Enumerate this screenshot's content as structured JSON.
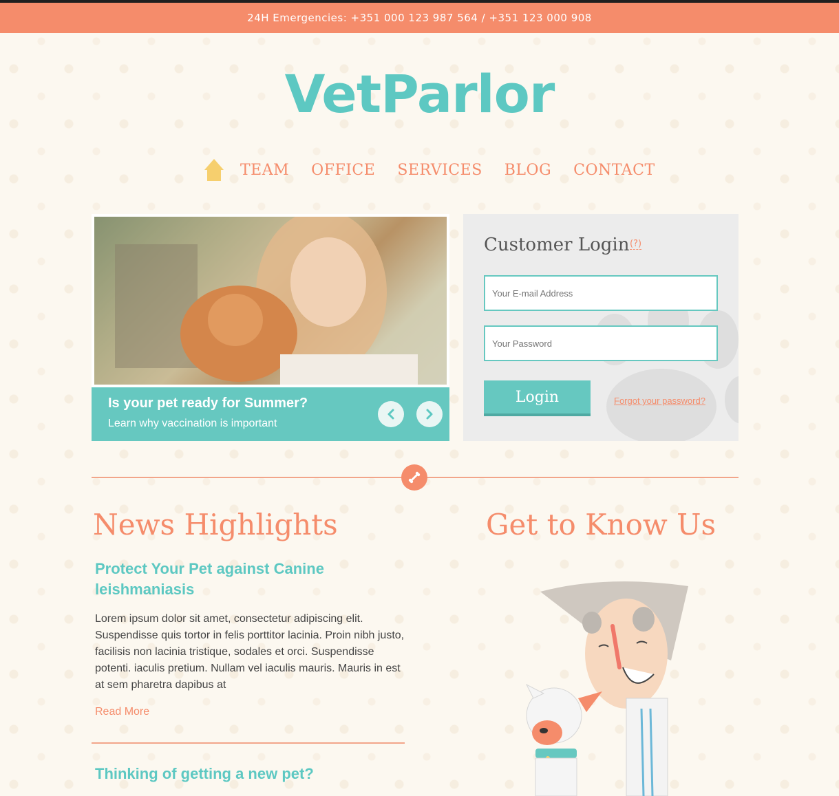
{
  "topbar": {
    "emergency_text": "24H Emergencies: +351 000 123 987 564 / +351 123 000 908"
  },
  "brand": {
    "logo_text": "VetParlor"
  },
  "nav": {
    "home_icon": "home-icon",
    "items": [
      {
        "label": "TEAM"
      },
      {
        "label": "OFFICE"
      },
      {
        "label": "SERVICES"
      },
      {
        "label": "BLOG"
      },
      {
        "label": "CONTACT"
      }
    ]
  },
  "slider": {
    "title": "Is your pet ready for Summer?",
    "subtitle": "Learn why vaccination is important",
    "prev_icon": "chevron-left-icon",
    "next_icon": "chevron-right-icon"
  },
  "login": {
    "title": "Customer Login",
    "help": "(?)",
    "email_placeholder": "Your E-mail Address",
    "password_placeholder": "Your Password",
    "button": "Login",
    "forgot": "Forgot your password?"
  },
  "news": {
    "heading": "News Highlights",
    "articles": [
      {
        "title": "Protect Your Pet against Canine leishmaniasis",
        "body": "Lorem ipsum dolor sit amet, consectetur adipiscing elit. Suspendisse quis tortor in felis porttitor lacinia. Proin nibh justo, facilisis non lacinia tristique, sodales et orci. Suspendisse potenti. iaculis pretium. Nullam vel iaculis mauris. Mauris in est at sem pharetra dapibus at",
        "read_more": "Read More"
      },
      {
        "title": "Thinking of getting a new pet?"
      }
    ]
  },
  "about": {
    "heading": "Get to Know Us"
  },
  "colors": {
    "accent_teal": "#5dc8c2",
    "accent_coral": "#f58c6b",
    "background": "#fcf8f0"
  }
}
